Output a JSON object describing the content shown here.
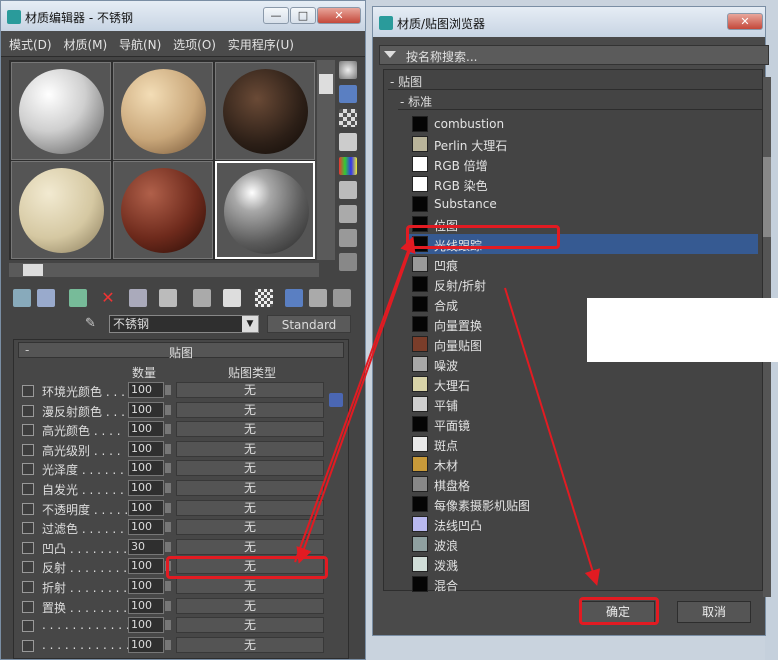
{
  "mat_editor": {
    "title": "材质编辑器 - 不锈钢",
    "menus": [
      "模式(D)",
      "材质(M)",
      "导航(N)",
      "选项(O)",
      "实用程序(U)"
    ],
    "material_name": "不锈钢",
    "standard_btn": "Standard",
    "rollout_title": "贴图",
    "col_amount": "数量",
    "col_maptype": "贴图类型",
    "rows": [
      {
        "label": "环境光颜色 . . .",
        "amount": "100",
        "map": "无"
      },
      {
        "label": "漫反射颜色 . . .",
        "amount": "100",
        "map": "无"
      },
      {
        "label": "高光颜色 . . . .",
        "amount": "100",
        "map": "无"
      },
      {
        "label": "高光级别 . . . .",
        "amount": "100",
        "map": "无"
      },
      {
        "label": "光泽度 . . . . . .",
        "amount": "100",
        "map": "无"
      },
      {
        "label": "自发光 . . . . . .",
        "amount": "100",
        "map": "无"
      },
      {
        "label": "不透明度 . . . . .",
        "amount": "100",
        "map": "无"
      },
      {
        "label": "过滤色 . . . . . .",
        "amount": "100",
        "map": "无"
      },
      {
        "label": "凹凸 . . . . . . . .",
        "amount": "30",
        "map": "无"
      },
      {
        "label": "反射 . . . . . . . .",
        "amount": "100",
        "map": "无"
      },
      {
        "label": "折射 . . . . . . . .",
        "amount": "100",
        "map": "无"
      },
      {
        "label": "置换 . . . . . . . .",
        "amount": "100",
        "map": "无"
      },
      {
        "label": ". . . . . . . . . . . .",
        "amount": "100",
        "map": "无"
      },
      {
        "label": ". . . . . . . . . . . .",
        "amount": "100",
        "map": "无"
      }
    ],
    "win_buttons": {
      "min": "—",
      "max": "□",
      "close": "✕"
    }
  },
  "browser": {
    "title": "材质/贴图浏览器",
    "search_placeholder": "按名称搜索...",
    "group_maps": "- 贴图",
    "group_standard": "- 标准",
    "items": [
      {
        "label": "combustion",
        "swatch": "#050505"
      },
      {
        "label": "Perlin 大理石",
        "swatch": "#b9b49a"
      },
      {
        "label": "RGB 倍增",
        "swatch": "#ffffff"
      },
      {
        "label": "RGB 染色",
        "swatch": "#ffffff"
      },
      {
        "label": "Substance",
        "swatch": "#050505"
      },
      {
        "label": "位图",
        "swatch": "#050505"
      },
      {
        "label": "光线跟踪",
        "swatch": "#050505"
      },
      {
        "label": "凹痕",
        "swatch": "#9a9a9a"
      },
      {
        "label": "反射/折射",
        "swatch": "#050505"
      },
      {
        "label": "合成",
        "swatch": "#050505"
      },
      {
        "label": "向量置换",
        "swatch": "#050505"
      },
      {
        "label": "向量贴图",
        "swatch": "#7a3d2a"
      },
      {
        "label": "噪波",
        "swatch": "#a8a8a8"
      },
      {
        "label": "大理石",
        "swatch": "#d8d3a8"
      },
      {
        "label": "平铺",
        "swatch": "#cfcfcf"
      },
      {
        "label": "平面镜",
        "swatch": "#050505"
      },
      {
        "label": "斑点",
        "swatch": "#e8e8e8"
      },
      {
        "label": "木材",
        "swatch": "#c89a3a"
      },
      {
        "label": "棋盘格",
        "swatch": "#888888"
      },
      {
        "label": "每像素摄影机贴图",
        "swatch": "#050505"
      },
      {
        "label": "法线凹凸",
        "swatch": "#b8b8ee"
      },
      {
        "label": "波浪",
        "swatch": "#8fa0a0"
      },
      {
        "label": "泼溅",
        "swatch": "#d0ddd8"
      },
      {
        "label": "混合",
        "swatch": "#050505"
      }
    ],
    "ok": "确定",
    "cancel": "取消",
    "close": "✕"
  },
  "accent_red": "#e21b22"
}
